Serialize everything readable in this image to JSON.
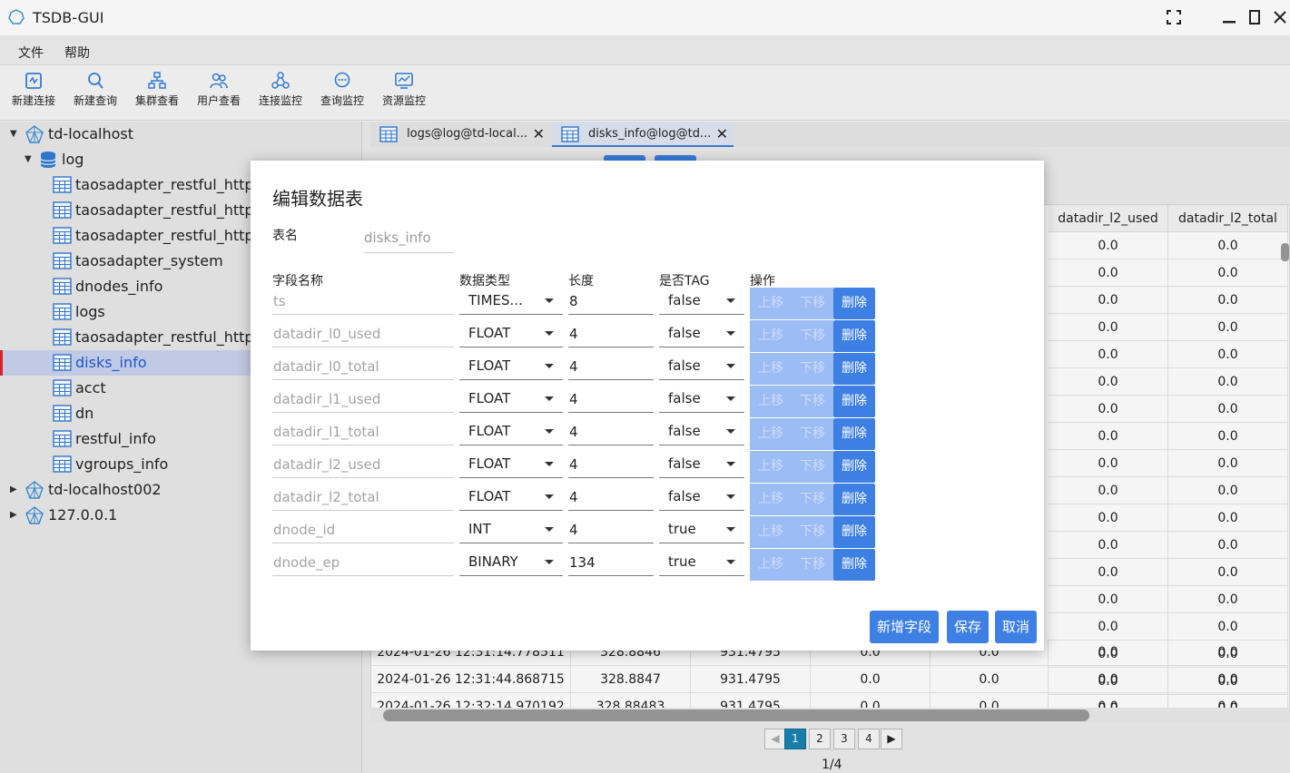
{
  "window": {
    "title": "TSDB-GUI"
  },
  "menu": [
    "文件",
    "帮助"
  ],
  "toolbar": [
    "新建连接",
    "新建查询",
    "集群查看",
    "用户查看",
    "连接监控",
    "查询监控",
    "资源监控"
  ],
  "tree": {
    "conn1": "td-localhost",
    "db": "log",
    "tables": [
      "taosadapter_restful_http_re",
      "taosadapter_restful_http_re",
      "taosadapter_restful_http_fa",
      "taosadapter_system",
      "dnodes_info",
      "logs",
      "taosadapter_restful_http_to",
      "disks_info",
      "acct",
      "dn",
      "restful_info",
      "vgroups_info"
    ],
    "conn2": "td-localhost002",
    "conn3": "127.0.0.1"
  },
  "tabs": [
    {
      "label": "logs@log@td-local...",
      "close": "✕"
    },
    {
      "label": "disks_info@log@td...",
      "close": "✕"
    }
  ],
  "grid": {
    "headers": [
      "datadir_l2_used",
      "datadir_l2_total"
    ],
    "right_values": "0.0",
    "bottom_rows": [
      [
        "2024-01-26 12:31:14.778511",
        "328.8846",
        "931.4795",
        "0.0",
        "0.0",
        "0.0",
        "0.0"
      ],
      [
        "2024-01-26 12:31:44.868715",
        "328.8847",
        "931.4795",
        "0.0",
        "0.0",
        "0.0",
        "0.0"
      ],
      [
        "2024-01-26 12:32:14.970192",
        "328.88483",
        "931.4795",
        "0.0",
        "0.0",
        "0.0",
        "0.0"
      ]
    ]
  },
  "pager": {
    "pages": [
      "1",
      "2",
      "3",
      "4"
    ],
    "current": 1,
    "info": "1/4",
    "prev": "◀",
    "next": "▶"
  },
  "dialog": {
    "title": "编辑数据表",
    "table_name_label": "表名",
    "table_name_value": "disks_info",
    "col_headers": [
      "字段名称",
      "数据类型",
      "长度",
      "是否TAG",
      "操作"
    ],
    "fields": [
      {
        "name": "ts",
        "type": "TIMES...",
        "length": "8",
        "tag": "false"
      },
      {
        "name": "datadir_l0_used",
        "type": "FLOAT",
        "length": "4",
        "tag": "false"
      },
      {
        "name": "datadir_l0_total",
        "type": "FLOAT",
        "length": "4",
        "tag": "false"
      },
      {
        "name": "datadir_l1_used",
        "type": "FLOAT",
        "length": "4",
        "tag": "false"
      },
      {
        "name": "datadir_l1_total",
        "type": "FLOAT",
        "length": "4",
        "tag": "false"
      },
      {
        "name": "datadir_l2_used",
        "type": "FLOAT",
        "length": "4",
        "tag": "false"
      },
      {
        "name": "datadir_l2_total",
        "type": "FLOAT",
        "length": "4",
        "tag": "false"
      },
      {
        "name": "dnode_id",
        "type": "INT",
        "length": "4",
        "tag": "true"
      },
      {
        "name": "dnode_ep",
        "type": "BINARY",
        "length": "134",
        "tag": "true"
      }
    ],
    "op_labels": {
      "up": "上移",
      "down": "下移",
      "delete": "删除"
    },
    "buttons": {
      "add": "新增字段",
      "save": "保存",
      "cancel": "取消"
    }
  },
  "colors": {
    "accent": "#3d7fe3",
    "accent_light": "#9bbcf5",
    "pager_active": "#1a84b0",
    "selection_mark": "#e0242b"
  }
}
